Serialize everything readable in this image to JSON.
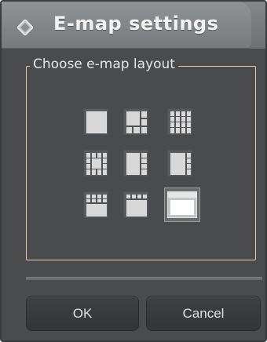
{
  "dialog": {
    "title": "E-map settings",
    "title_icon": "diamond-icon"
  },
  "layout_group": {
    "legend": "Choose e-map layout",
    "options": [
      {
        "id": "single",
        "icon": "layout-1x1-icon",
        "selected": false
      },
      {
        "id": "one-plus-five",
        "icon": "layout-1-plus-5-icon",
        "selected": false
      },
      {
        "id": "grid-4x4",
        "icon": "layout-4x4-icon",
        "selected": false
      },
      {
        "id": "center-plus-ring",
        "icon": "layout-center-ring-icon",
        "selected": false
      },
      {
        "id": "big-left-column-right",
        "icon": "layout-big-left-icon",
        "selected": false
      },
      {
        "id": "big-left-narrow-right",
        "icon": "layout-big-left-narrow-icon",
        "selected": false
      },
      {
        "id": "top-row-big-bottom",
        "icon": "layout-top-row-icon",
        "selected": false
      },
      {
        "id": "top-strip-big-bottom",
        "icon": "layout-top-strip-icon",
        "selected": false
      },
      {
        "id": "window",
        "icon": "layout-window-icon",
        "selected": true
      }
    ]
  },
  "buttons": {
    "ok": "OK",
    "cancel": "Cancel"
  },
  "colors": {
    "background": "#4a4b4d",
    "groupbox_border": "#e8c9a8",
    "titlebar": "#84878a"
  }
}
